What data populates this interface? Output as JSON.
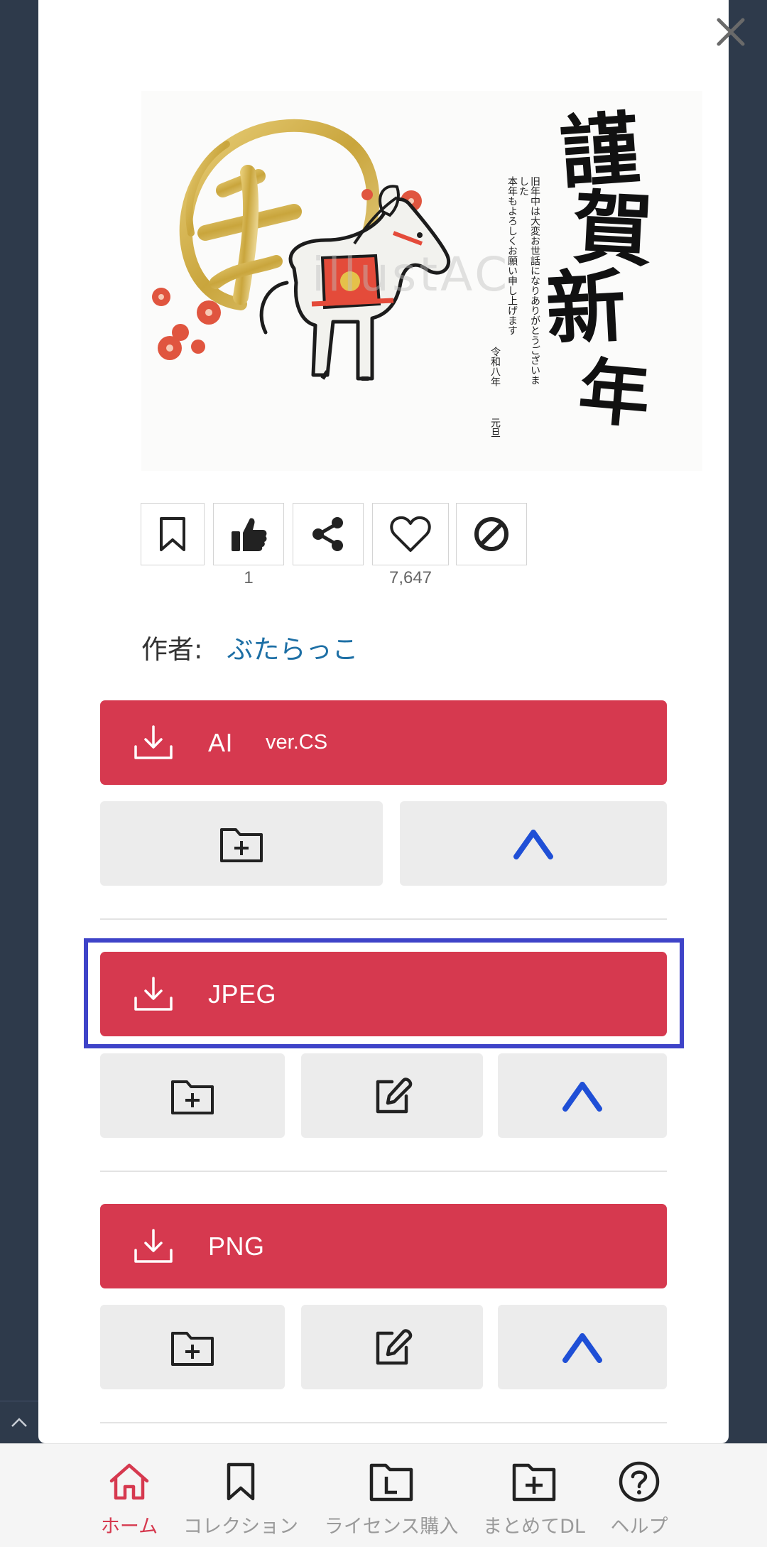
{
  "artwork": {
    "watermark": "illustAC",
    "calligraphy": [
      "謹",
      "賀",
      "新",
      "年"
    ],
    "greeting_lines": [
      "旧年中は大変お世話になりありがとうございました",
      "本年もよろしくお願い申し上げます",
      "令和八年",
      "元旦"
    ],
    "seal_char": "午"
  },
  "actions": {
    "like_count": "1",
    "favorite_count": "7,647"
  },
  "author": {
    "label": "作者:",
    "name": "ぶたらっこ"
  },
  "downloads": [
    {
      "label": "AI",
      "sub": "ver.CS"
    },
    {
      "label": "JPEG",
      "sub": ""
    },
    {
      "label": "PNG",
      "sub": ""
    }
  ],
  "nav": [
    {
      "label": "ホーム",
      "icon": "home-icon",
      "active": true
    },
    {
      "label": "コレクション",
      "icon": "bookmark-icon",
      "active": false
    },
    {
      "label": "ライセンス購入",
      "icon": "license-icon",
      "active": false
    },
    {
      "label": "まとめてDL",
      "icon": "folder-plus-icon",
      "active": false
    },
    {
      "label": "ヘルプ",
      "icon": "help-icon",
      "active": false
    }
  ],
  "colors": {
    "download": "#d6394f",
    "accent_blue": "#1f4fd6",
    "author_link": "#1d6fa5",
    "nav_active": "#d6394f",
    "highlight": "#3e43c8"
  }
}
